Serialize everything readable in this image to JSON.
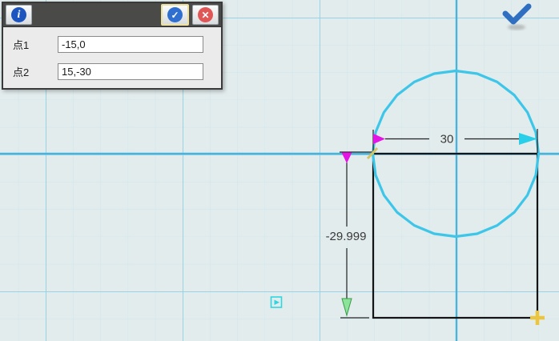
{
  "dialog": {
    "field1": {
      "label": "点1",
      "value": "-15,0"
    },
    "field2": {
      "label": "点2",
      "value": "15,-30"
    },
    "icons": {
      "info": "i",
      "confirm": "✓",
      "cancel": "✕"
    }
  },
  "canvas": {
    "dimensions": {
      "horizontal": "30",
      "vertical": "-29.999"
    },
    "colors": {
      "background": "#e3eced",
      "grid_minor": "#cbe6ef",
      "grid_major": "#92cfe6",
      "axis": "#48b4dc",
      "circle_stroke": "#3ec6e9",
      "shape_stroke": "#141414",
      "dim_text": "#3a3a3a",
      "dim_start_arrow": "#e414e4",
      "dim_end_arrow_horizontal": "#29cfe8",
      "dim_end_arrow_vertical": "#8be49a",
      "corner_tick": "#d6c564",
      "point_cross": "#ecc53e",
      "snap_indicator": "#2fd5df",
      "confirm_check": "#2e6fc2"
    }
  }
}
